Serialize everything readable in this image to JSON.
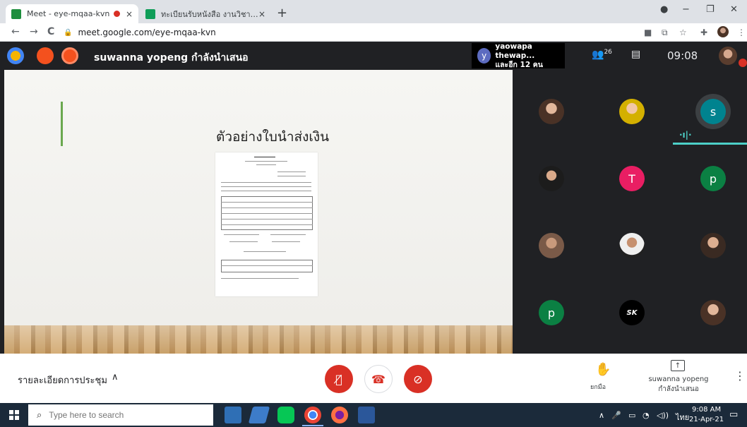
{
  "browser": {
    "tabs": [
      {
        "title": "Meet - eye-mqaa-kvn",
        "close": "×"
      },
      {
        "title": "ทะเบียนรับหนังสือ งานวิชาการฯ - Goo",
        "close": "×"
      }
    ],
    "new_tab": "+",
    "window": {
      "minimize": "−",
      "restore": "❐",
      "close": "✕"
    },
    "nav": {
      "back": "←",
      "forward": "→",
      "reload": "C"
    },
    "url": "meet.google.com/eye-mqaa-kvn"
  },
  "meet": {
    "presenter_banner": "suwanna yopeng กำลังนำเสนอ",
    "pinned": {
      "initial": "y",
      "name": "yaowapa thewap...",
      "others": "และอีก 12 คน"
    },
    "participants_count": "26",
    "clock": "09:08",
    "slide": {
      "heading": "ตัวอย่างใบนำส่งเงิน"
    },
    "grid_letters": {
      "s": "s",
      "t": "T",
      "p1": "p",
      "p2": "p",
      "sk": "SK"
    },
    "bottom": {
      "meeting_details": "รายละเอียดการประชุม",
      "raise_hand_label": "ยกมือ",
      "presenter_line1": "suwanna yopeng",
      "presenter_line2": "กำลังนำเสนอ"
    }
  },
  "taskbar": {
    "search_placeholder": "Type here to search",
    "time": "9:08 AM",
    "date": "21-Apr-21",
    "lang": "ไทย"
  },
  "colors": {
    "accent_red": "#d93025",
    "teal": "#4dd0c8",
    "meet_dark": "#202124"
  }
}
